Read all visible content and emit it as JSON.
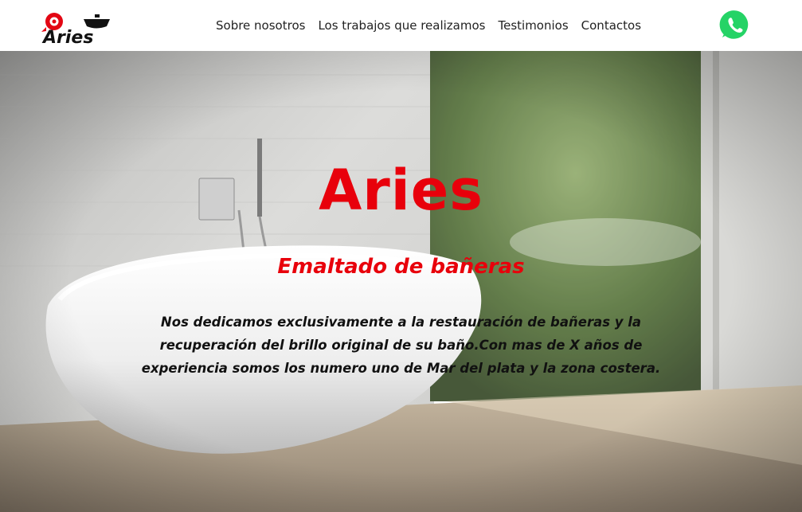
{
  "header": {
    "logo_text": "Aries",
    "nav": [
      {
        "label": "Sobre nosotros"
      },
      {
        "label": "Los trabajos que realizamos"
      },
      {
        "label": "Testimonios"
      },
      {
        "label": "Contactos"
      }
    ],
    "whatsapp_icon": "whatsapp-icon"
  },
  "hero": {
    "title": "Aries",
    "subtitle": "Emaltado de bañeras",
    "description": "Nos dedicamos exclusivamente a la restauración de bañeras y la recuperación del brillo original de su baño.Con mas de X años de experiencia somos los numero uno de Mar del plata y la zona costera."
  },
  "colors": {
    "accent": "#e8000b",
    "whatsapp": "#25d366",
    "text_dark": "#111111"
  }
}
